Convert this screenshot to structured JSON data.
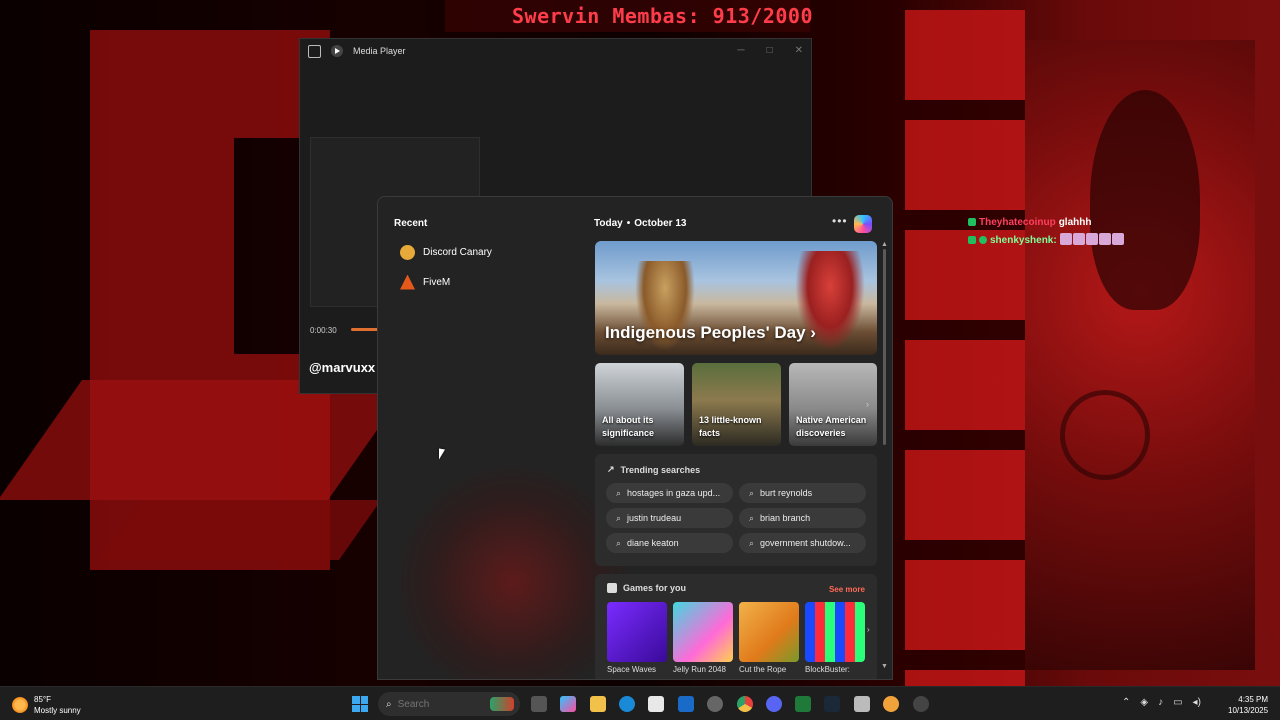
{
  "stream": {
    "title": "Swervin Membas: 913/2000"
  },
  "chat": {
    "lines": [
      {
        "user": "Theyhatecoinup",
        "message": "glahhh"
      },
      {
        "user": "shenkyshenk:",
        "message": ""
      }
    ]
  },
  "media_player": {
    "title": "Media Player",
    "time": "0:00:30",
    "artist": "@marvuxx",
    "progress_fraction": 0.05
  },
  "start_panel": {
    "recent_title": "Recent",
    "recent_items": [
      {
        "label": "Discord Canary",
        "icon": "discord-canary-icon"
      },
      {
        "label": "FiveM",
        "icon": "fivem-icon"
      }
    ],
    "today_label": "Today",
    "date_label": "October 13",
    "more_label": "•••",
    "hero": {
      "title": "Indigenous Peoples' Day ›"
    },
    "cards": [
      {
        "label": "All about its significance"
      },
      {
        "label": "13 little-known facts"
      },
      {
        "label": "Native American discoveries"
      }
    ],
    "trending": {
      "title": "Trending searches",
      "items": [
        "hostages in gaza upd...",
        "burt reynolds",
        "justin trudeau",
        "brian branch",
        "diane keaton",
        "government shutdow..."
      ]
    },
    "games": {
      "title": "Games for you",
      "see_more": "See more",
      "items": [
        {
          "name": "Space Waves"
        },
        {
          "name": "Jelly Run 2048"
        },
        {
          "name": "Cut the Rope"
        },
        {
          "name": "BlockBuster:"
        }
      ]
    }
  },
  "taskbar": {
    "weather_temp": "85°F",
    "weather_desc": "Mostly sunny",
    "search_placeholder": "Search",
    "time": "4:35 PM",
    "date": "10/13/2025"
  },
  "colors": {
    "accent": "#3ba8f0",
    "see_more": "#ff6a55",
    "stream_title": "#ff3d4a"
  }
}
